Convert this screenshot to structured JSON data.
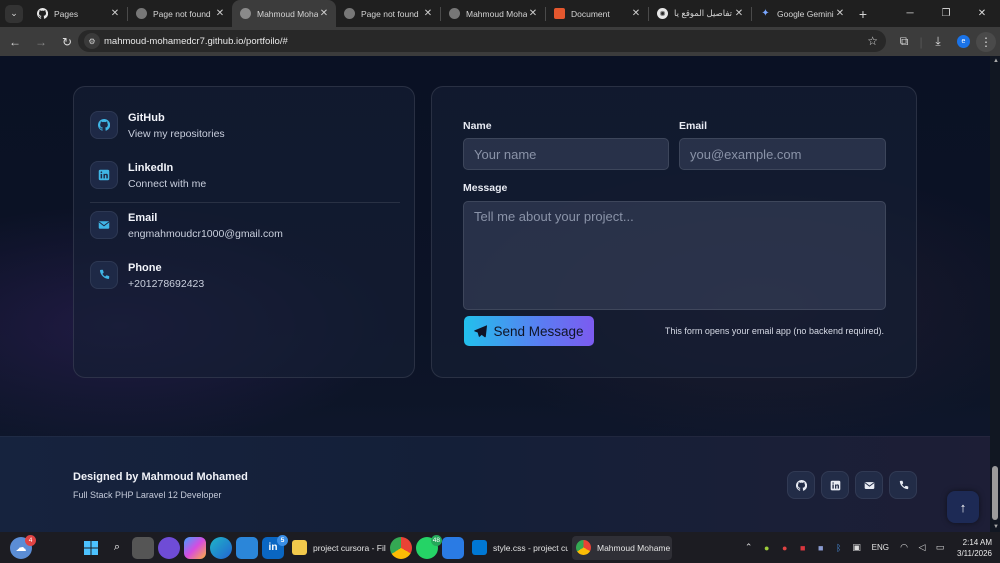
{
  "browser": {
    "tabs": [
      {
        "title": "Pages",
        "favicon": "github-icon",
        "active": false
      },
      {
        "title": "Page not found",
        "favicon": "globe-icon",
        "active": false
      },
      {
        "title": "Mahmoud Moha",
        "favicon": "globe-icon",
        "active": true
      },
      {
        "title": "Page not found",
        "favicon": "globe-icon",
        "active": false
      },
      {
        "title": "Mahmoud Moha",
        "favicon": "globe-icon",
        "active": false
      },
      {
        "title": "Document",
        "favicon": "html-icon",
        "active": false
      },
      {
        "title": "تفاصيل الموقع يا",
        "favicon": "chatgpt-icon",
        "active": false
      },
      {
        "title": "Google Gemini",
        "favicon": "gemini-icon",
        "active": false
      }
    ],
    "url": "mahmoud-mohamedcr7.github.io/portfoilo/#",
    "profile_initial": "e"
  },
  "contact": {
    "items": [
      {
        "title": "GitHub",
        "subtitle": "View my repositories",
        "icon": "github-icon"
      },
      {
        "title": "LinkedIn",
        "subtitle": "Connect with me",
        "icon": "linkedin-icon"
      },
      {
        "title": "Email",
        "subtitle": "engmahmoudcr1000@gmail.com",
        "icon": "mail-icon"
      },
      {
        "title": "Phone",
        "subtitle": "+201278692423",
        "icon": "phone-icon"
      }
    ]
  },
  "form": {
    "name_label": "Name",
    "name_placeholder": "Your name",
    "email_label": "Email",
    "email_placeholder": "you@example.com",
    "message_label": "Message",
    "message_placeholder": "Tell me about your project...",
    "send_label": "Send Message",
    "note": "This form opens your email app (no backend required)."
  },
  "footer": {
    "title": "Designed by Mahmoud Mohamed",
    "subtitle": "Full Stack PHP Laravel 12 Developer",
    "socials": [
      "github-icon",
      "linkedin-icon",
      "mail-icon",
      "phone-icon"
    ]
  },
  "taskbar": {
    "weather_badge": "4",
    "linkedin_badge": "5",
    "whatsapp_badge": "48",
    "apps": [
      {
        "label": "project cursora - File",
        "icon": "folder-icon"
      },
      {
        "label": "style.css - project cu",
        "icon": "vscode-icon"
      },
      {
        "label": "Mahmoud Mohame",
        "icon": "chrome-icon"
      }
    ],
    "language": "ENG",
    "time": "2:14 AM",
    "date": "3/11/2026"
  },
  "colors": {
    "accent_gradient_start": "#22c0ec",
    "accent_gradient_end": "#7c5bf0",
    "icon_accent": "#3fb6e6",
    "page_bg": "#0b1020"
  }
}
